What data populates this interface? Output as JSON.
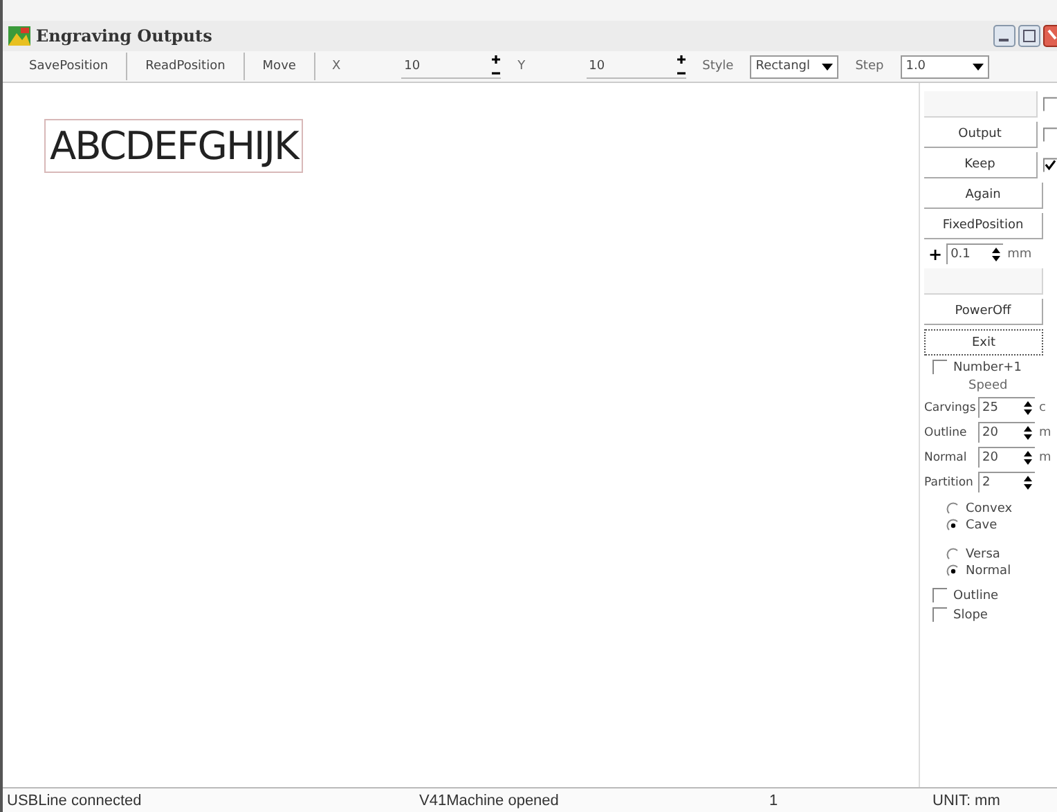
{
  "window": {
    "title": "Engraving Outputs"
  },
  "toolbar": {
    "buttons": [
      "SavePosition",
      "ReadPosition",
      "Move"
    ],
    "fields": [
      {
        "kind": "spin",
        "label": "X",
        "value": "10"
      },
      {
        "kind": "spin",
        "label": "Y",
        "value": "10"
      },
      {
        "kind": "combo",
        "label": "Style",
        "value": "Rectangl"
      },
      {
        "kind": "combo",
        "label": "Step",
        "value": "1.0"
      }
    ]
  },
  "canvas": {
    "text": "ABCDEFGHIJK"
  },
  "side_panel": [
    {
      "kind": "button",
      "disabled": true,
      "checked": false
    },
    {
      "kind": "button",
      "label": "Output",
      "disabled": false,
      "checked": false
    },
    {
      "kind": "button",
      "label": "Keep",
      "disabled": false,
      "checked": true
    },
    {
      "kind": "button",
      "label": "Again",
      "disabled": false,
      "focused": false
    },
    {
      "kind": "button",
      "label": "FixedPosition",
      "disabled": false,
      "focused": false
    },
    {
      "kind": "step",
      "prefix": "+",
      "value": "0.1",
      "unit": "mm"
    },
    {
      "kind": "button",
      "disabled": true,
      "focused": false
    },
    {
      "kind": "button",
      "label": "PowerOff",
      "disabled": false,
      "focused": false
    },
    {
      "kind": "button",
      "label": "Exit",
      "disabled": false,
      "focused": true
    },
    {
      "kind": "check",
      "label": "Number+1",
      "checked": false
    },
    {
      "kind": "heading",
      "label": "Speed"
    },
    {
      "kind": "spin",
      "label": "Carvings",
      "value": "25",
      "unit": "c"
    },
    {
      "kind": "spin",
      "label": "Outline",
      "value": "20",
      "unit": "m"
    },
    {
      "kind": "spin",
      "label": "Normal",
      "value": "20",
      "unit": "m"
    },
    {
      "kind": "spin",
      "label": "Partition",
      "value": "2"
    },
    {
      "kind": "radio_group",
      "options": [
        {
          "label": "Convex",
          "selected": false
        },
        {
          "label": "Cave",
          "selected": true
        }
      ]
    },
    {
      "kind": "radio_group",
      "options": [
        {
          "label": "Versa",
          "selected": false
        },
        {
          "label": "Normal",
          "selected": true
        }
      ]
    },
    {
      "kind": "check",
      "label": "Outline",
      "checked": false
    },
    {
      "kind": "check",
      "label": "Slope",
      "checked": false
    }
  ],
  "status_bar": [
    "USBLine connected",
    "V41Machine opened",
    "1",
    "UNIT: mm"
  ]
}
